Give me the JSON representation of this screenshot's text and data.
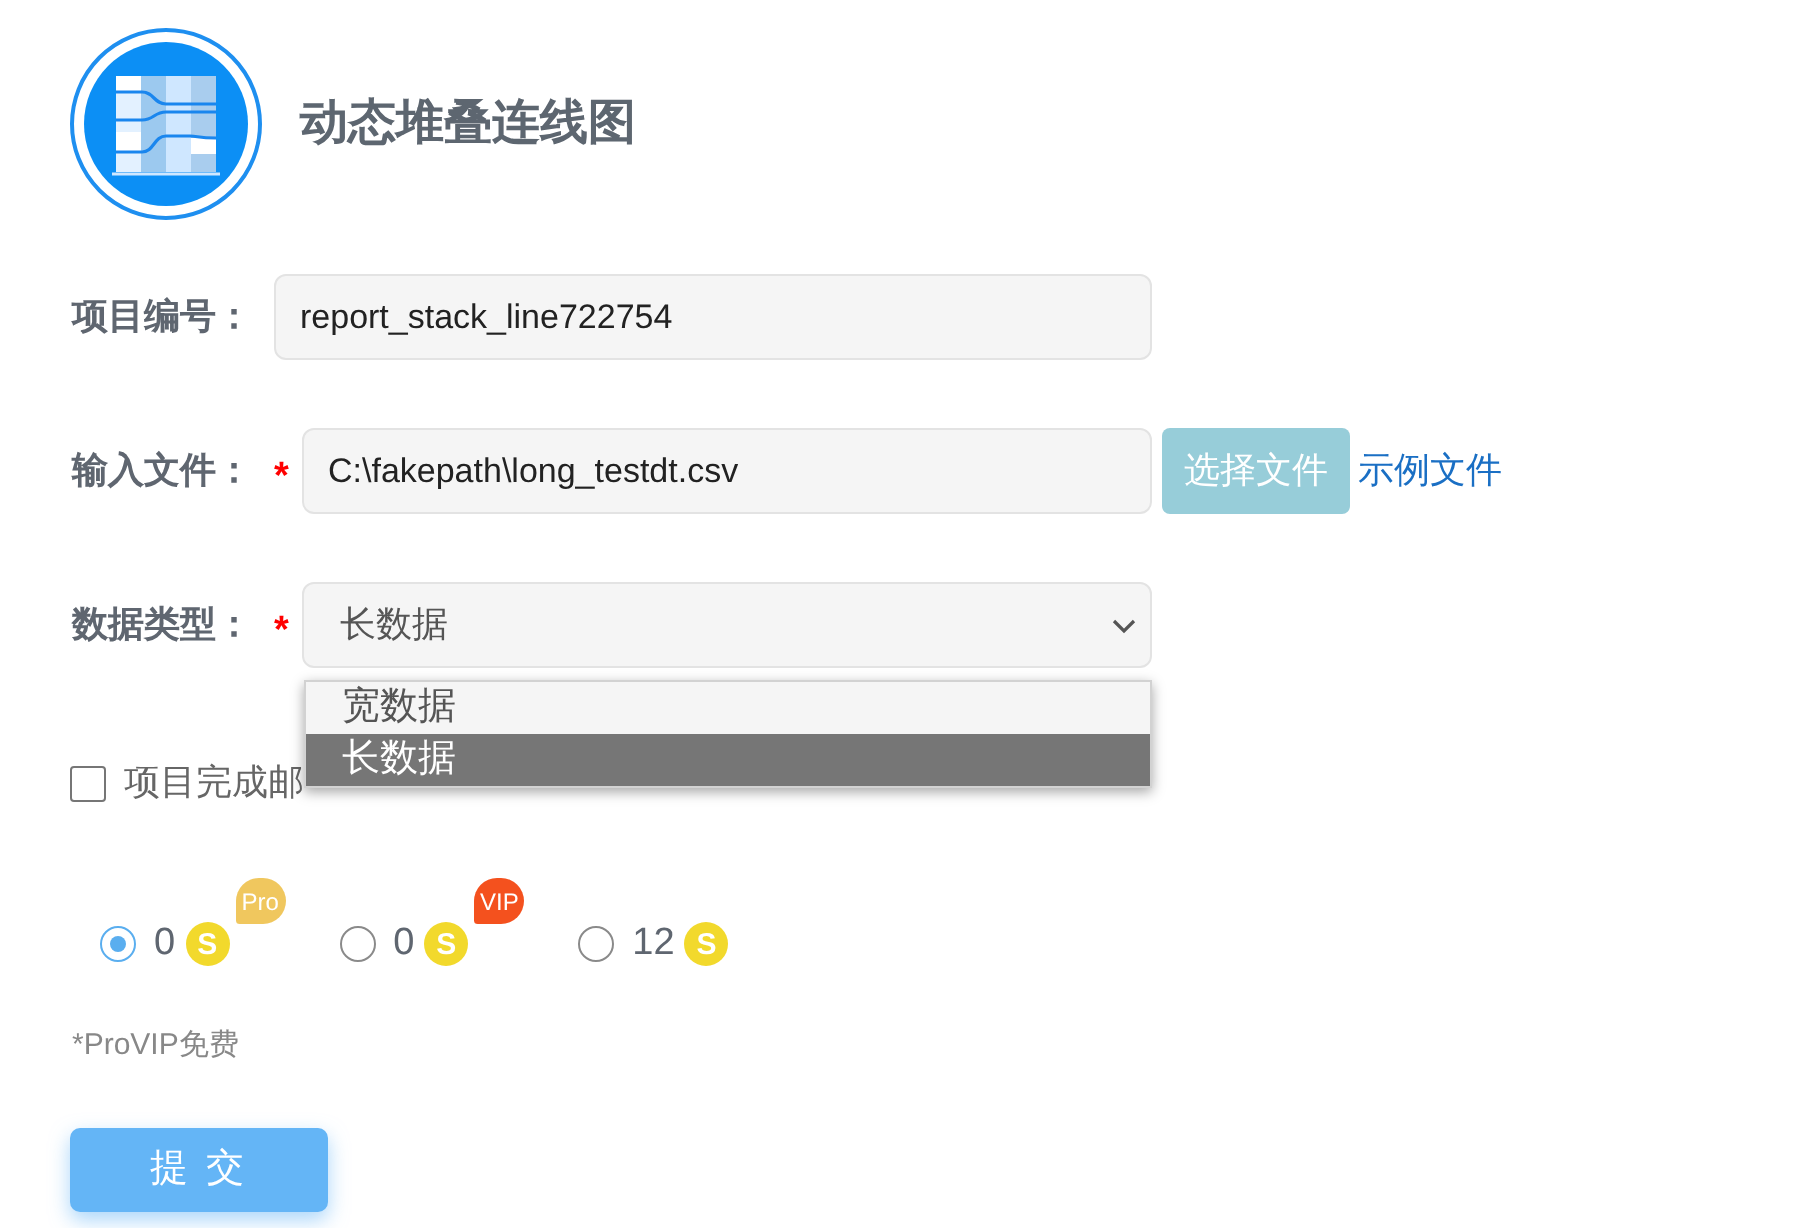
{
  "header": {
    "title": "动态堆叠连线图"
  },
  "fields": [
    {
      "kind": "text",
      "label": "项目编号：",
      "value": "report_stack_line722754"
    },
    {
      "kind": "file",
      "label": "输入文件：",
      "required_mark": "*",
      "value": "C:\\fakepath\\long_testdt.csv",
      "button": "选择文件",
      "link": "示例文件"
    },
    {
      "kind": "select",
      "label": "数据类型：",
      "required_mark": "*",
      "value": "长数据",
      "expanded": true,
      "options": [
        {
          "label": "宽数据",
          "selected": false
        },
        {
          "label": "长数据",
          "selected": true
        }
      ]
    }
  ],
  "notify": {
    "label": "项目完成邮",
    "checked": false
  },
  "plans": [
    {
      "selected": true,
      "price": "0",
      "coin": "S",
      "badge": "Pro",
      "color": "#f0c75e"
    },
    {
      "selected": false,
      "price": "0",
      "coin": "S",
      "badge": "VIP",
      "color": "#f4511e"
    },
    {
      "selected": false,
      "price": "12",
      "coin": "S"
    }
  ],
  "note": "*ProVIP免费",
  "submit": "提 交"
}
